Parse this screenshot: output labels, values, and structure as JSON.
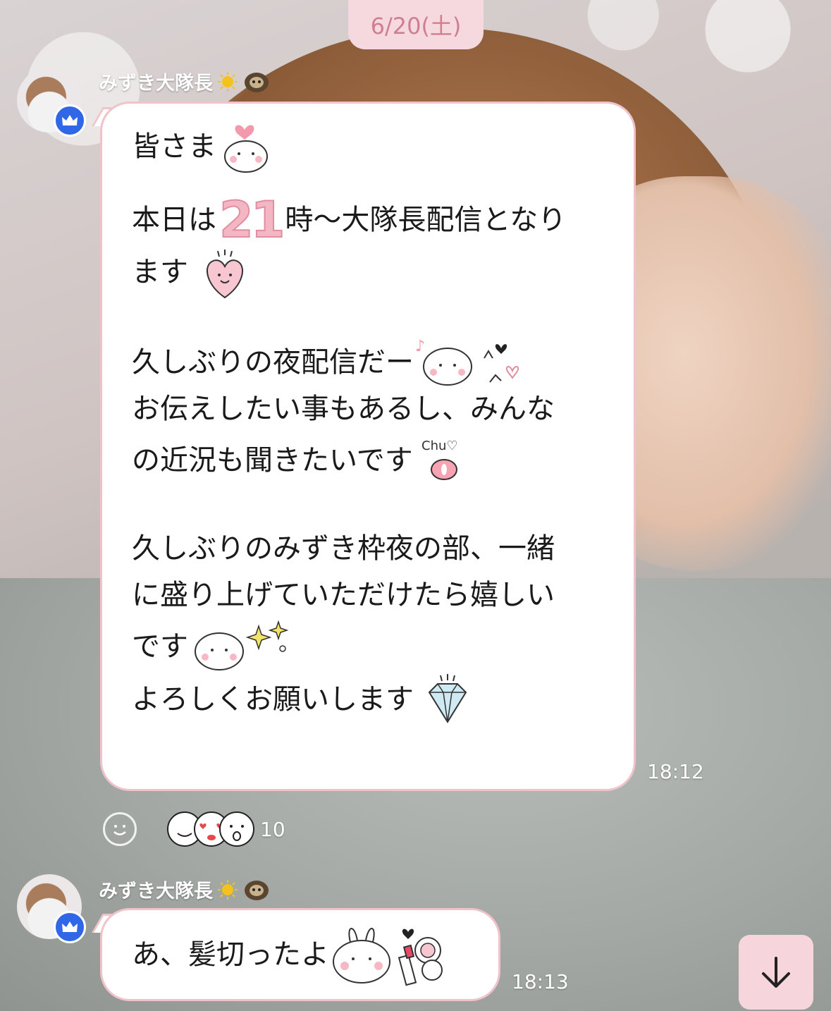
{
  "date_pill": "6/20(土)",
  "messages": [
    {
      "sender": "みずき大隊長",
      "time": "18:12",
      "lines": {
        "l1": "皆さま",
        "l2a": "本日は",
        "l2num": "21",
        "l2b": "時〜大隊長配信となり",
        "l3": "ます",
        "l4": "久しぶりの夜配信だー",
        "l5": "お伝えしたい事もあるし、みんな",
        "l6": "の近況も聞きたいです",
        "l7": "久しぶりのみずき枠夜の部、一緒",
        "l8": "に盛り上げていただけたら嬉しい",
        "l9": "です",
        "l10": "よろしくお願いします"
      },
      "reactions_count": "10"
    },
    {
      "sender": "みずき大隊長",
      "time": "18:13",
      "text": "あ、髪切ったよ"
    }
  ],
  "icons": {
    "badge": "crown-icon",
    "react": "smiley-icon",
    "scroll": "arrow-down-icon"
  },
  "colors": {
    "bubble_border": "#f0c3cb",
    "date_pill_bg": "#f5d9de",
    "date_pill_text": "#d07f90",
    "badge_blue": "#2f67e6",
    "scroll_btn_bg": "#f7d5dc"
  }
}
